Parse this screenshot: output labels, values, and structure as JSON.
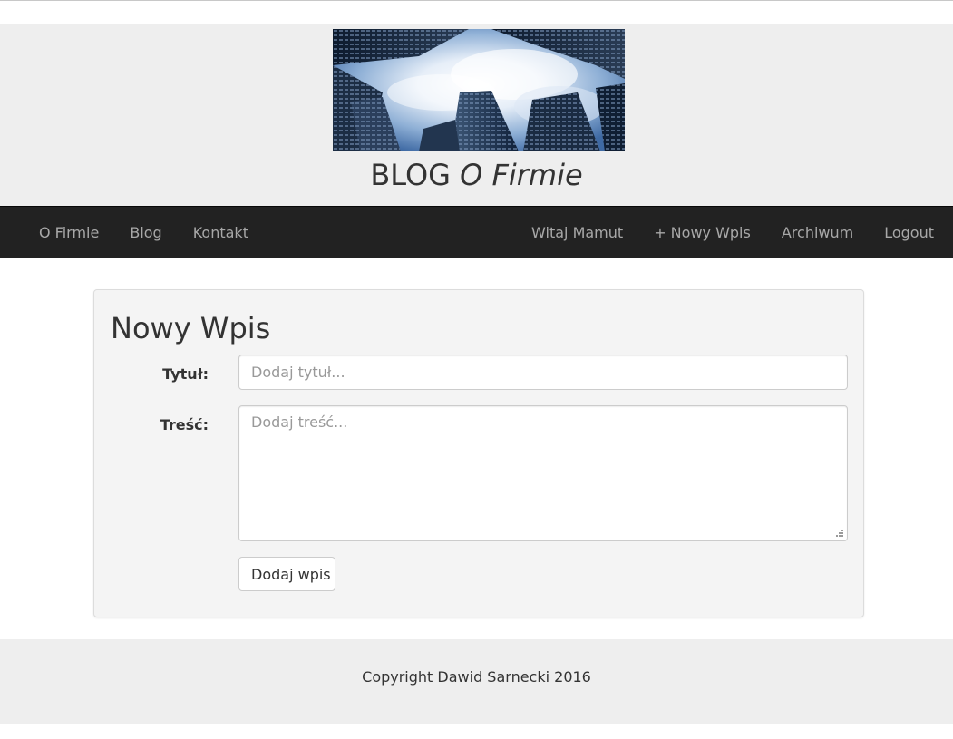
{
  "header": {
    "title_main": "BLOG",
    "title_emphasis": "O Firmie",
    "banner_alt": "Looking up at skyscrapers against a cloudy blue sky"
  },
  "navbar": {
    "left_items": [
      {
        "label": "O Firmie"
      },
      {
        "label": "Blog"
      },
      {
        "label": "Kontakt"
      }
    ],
    "right_items": [
      {
        "label": "Witaj Mamut"
      },
      {
        "label": "+ Nowy Wpis"
      },
      {
        "label": "Archiwum"
      },
      {
        "label": "Logout"
      }
    ],
    "background": "#222222",
    "link_color": "#a8a8a8"
  },
  "form": {
    "heading": "Nowy Wpis",
    "title_label": "Tytuł:",
    "title_value": "",
    "title_placeholder": "Dodaj tytuł...",
    "content_label": "Treść:",
    "content_value": "",
    "content_placeholder": "Dodaj treść...",
    "submit_label": "Dodaj wpis"
  },
  "footer": {
    "copyright": "Copyright Dawid Sarnecki 2016"
  },
  "icons": {
    "resize_grip": "resize-grip-icon"
  }
}
